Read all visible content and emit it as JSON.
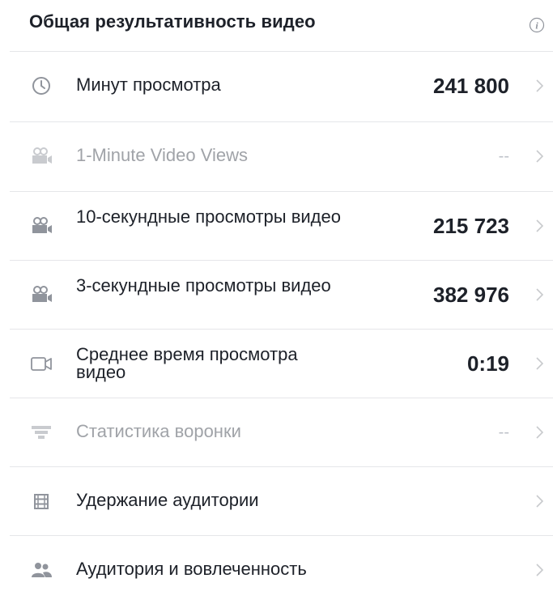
{
  "header": {
    "title": "Общая результативность видео",
    "info_icon": "info-icon"
  },
  "colors": {
    "text": "#1d2129",
    "dim_text": "#a0a3a8",
    "divider": "#e5e6e9",
    "icon": "#90949c",
    "chevron": "#c8cacd"
  },
  "rows": [
    {
      "label": "Минут просмотра",
      "value": "241 800",
      "icon": "clock-icon",
      "dimmed": false
    },
    {
      "label": "1-Minute Video Views",
      "value": "--",
      "icon": "film-camera-icon",
      "dimmed": true
    },
    {
      "label": "10-секундные просмотры видео",
      "value": "215 723",
      "icon": "film-camera-icon",
      "dimmed": false
    },
    {
      "label": "3-секундные просмотры видео",
      "value": "382 976",
      "icon": "film-camera-icon",
      "dimmed": false
    },
    {
      "label": "Среднее время просмотра видео",
      "value": "0:19",
      "icon": "video-camera-icon",
      "dimmed": false
    },
    {
      "label": "Статистика воронки",
      "value": "--",
      "icon": "funnel-icon",
      "dimmed": true
    },
    {
      "label": "Удержание аудитории",
      "value": "",
      "icon": "film-strip-icon",
      "dimmed": false
    },
    {
      "label": "Аудитория и вовлеченность",
      "value": "",
      "icon": "people-icon",
      "dimmed": false
    }
  ]
}
